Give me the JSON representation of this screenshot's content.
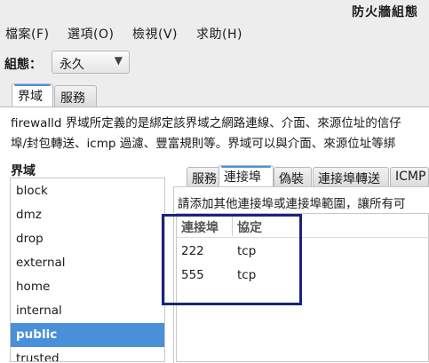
{
  "window": {
    "title": "防火牆組態"
  },
  "menu": {
    "items": [
      "檔案(F)",
      "選項(O)",
      "檢視(V)",
      "求助(H)"
    ]
  },
  "configuration": {
    "label": "組態：",
    "value": "永久"
  },
  "top_tabs": [
    "界域",
    "服務"
  ],
  "description": {
    "line1": "firewalld 界域所定義的是綁定該界域之網路連線、介面、來源位址的信仔",
    "line2": "埠/封包轉送、icmp 過濾、豐富規則等。界域可以與介面、來源位址等綁"
  },
  "zones": {
    "title": "界域",
    "items": [
      "block",
      "dmz",
      "drop",
      "external",
      "home",
      "internal",
      "public",
      "trusted"
    ],
    "selected": "public"
  },
  "sub_tabs": [
    "服務",
    "連接埠",
    "偽裝",
    "連接埠轉送",
    "ICMP"
  ],
  "ports": {
    "description": "請添加其他連接埠或連接埠範圍，讓所有可",
    "columns": [
      "連接埠",
      "協定"
    ],
    "rows": [
      {
        "port": "222",
        "protocol": "tcp"
      },
      {
        "port": "555",
        "protocol": "tcp"
      }
    ]
  },
  "colors": {
    "accent": "#4a90d9",
    "highlight_box": "#1a237e"
  }
}
